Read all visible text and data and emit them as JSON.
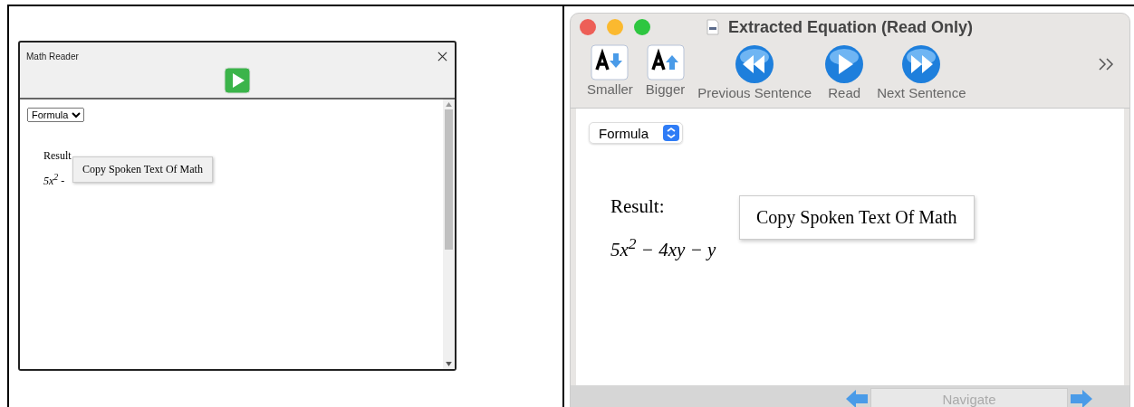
{
  "panels": [
    {
      "kind": "windows",
      "window": {
        "title": "Math Reader"
      },
      "toolbar": [
        {
          "kind": "play"
        }
      ],
      "dropdown": {
        "value": "Formula"
      },
      "result_label": "Result",
      "equation": "5x$^{2}$ -",
      "context_menu": {
        "items": [
          "Copy Spoken Text Of Math"
        ]
      }
    },
    {
      "kind": "mac",
      "window": {
        "title": "Extracted Equation (Read Only)"
      },
      "toolbar": [
        {
          "label": "Smaller",
          "kind": "smaller"
        },
        {
          "label": "Bigger",
          "kind": "bigger"
        },
        {
          "label": "Previous Sentence",
          "kind": "previous"
        },
        {
          "label": "Read",
          "kind": "read"
        },
        {
          "label": "Next Sentence",
          "kind": "next"
        }
      ],
      "dropdown": {
        "value": "Formula"
      },
      "result_label": "Result:",
      "equation": "5x$^{2}$ − 4xy − y",
      "context_menu": {
        "items": [
          "Copy Spoken Text Of Math"
        ]
      },
      "navigate": {
        "placeholder": "Navigate"
      }
    }
  ]
}
